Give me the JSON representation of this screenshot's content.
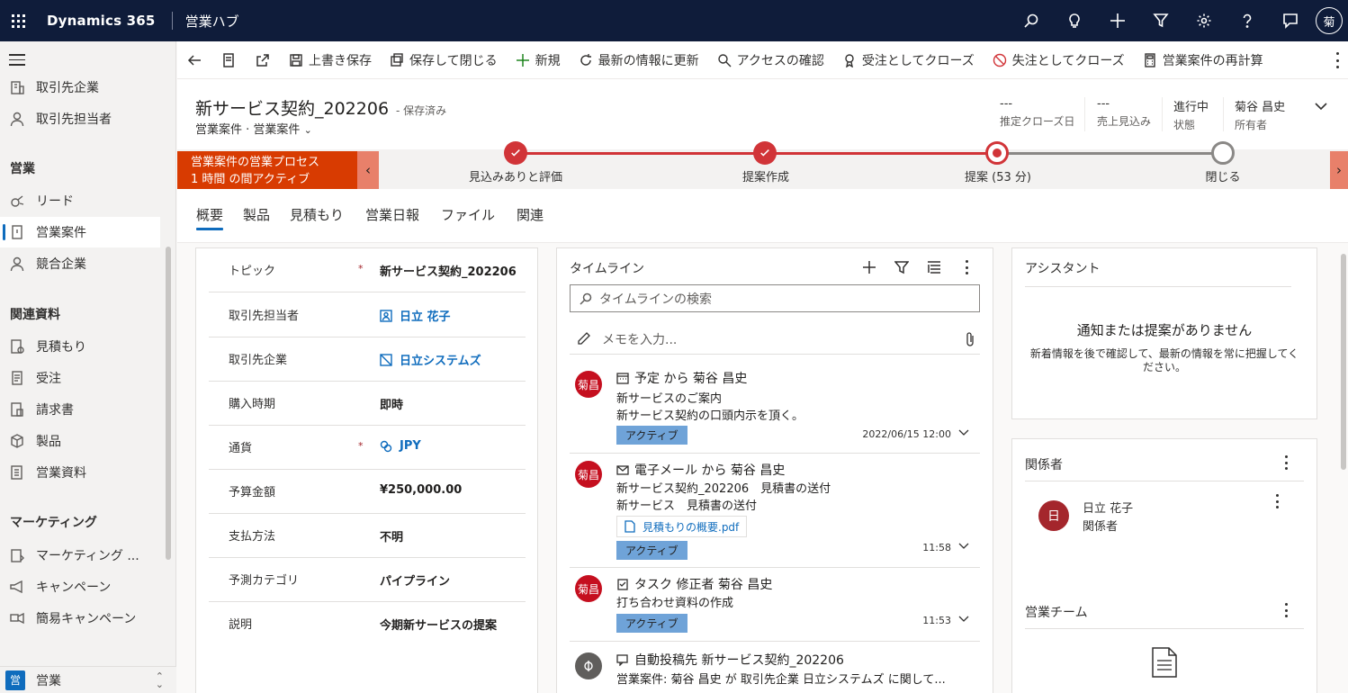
{
  "topbar": {
    "brand": "Dynamics 365",
    "app_name": "営業ハブ",
    "user_initial": "菊"
  },
  "sidebar": {
    "items_top": [
      {
        "label": "取引先企業",
        "icon": "building-icon"
      },
      {
        "label": "取引先担当者",
        "icon": "person-icon"
      }
    ],
    "groups": [
      {
        "title": "営業",
        "items": [
          {
            "label": "リード",
            "icon": "phone-icon"
          },
          {
            "label": "営業案件",
            "icon": "document-icon",
            "active": true
          },
          {
            "label": "競合企業",
            "icon": "person-icon"
          }
        ]
      },
      {
        "title": "関連資料",
        "items": [
          {
            "label": "見積もり",
            "icon": "quote-icon"
          },
          {
            "label": "受注",
            "icon": "order-icon"
          },
          {
            "label": "請求書",
            "icon": "invoice-icon"
          },
          {
            "label": "製品",
            "icon": "box-icon"
          },
          {
            "label": "営業資料",
            "icon": "library-icon"
          }
        ]
      },
      {
        "title": "マーケティング",
        "items": [
          {
            "label": "マーケティング ...",
            "icon": "list-icon"
          },
          {
            "label": "キャンペーン",
            "icon": "megaphone-icon"
          },
          {
            "label": "簡易キャンペーン",
            "icon": "quick-campaign-icon"
          }
        ]
      }
    ],
    "area": {
      "badge": "営",
      "label": "営業"
    }
  },
  "commandbar": {
    "save": "上書き保存",
    "save_close": "保存して閉じる",
    "new": "新規",
    "refresh": "最新の情報に更新",
    "check_access": "アクセスの確認",
    "close_won": "受注としてクローズ",
    "close_lost": "失注としてクローズ",
    "recalculate": "営業案件の再計算"
  },
  "header": {
    "title": "新サービス契約_202206",
    "saved_status": "- 保存済み",
    "entity": "営業案件",
    "form": "営業案件",
    "fields": [
      {
        "value": "---",
        "label": "推定クローズ日"
      },
      {
        "value": "---",
        "label": "売上見込み"
      },
      {
        "value": "進行中",
        "label": "状態"
      },
      {
        "value": "菊谷 昌史",
        "label": "所有者"
      }
    ]
  },
  "bpf": {
    "flyout_line1": "営業案件の営業プロセス",
    "flyout_line2": "1 時間 の間アクティブ",
    "stages": [
      {
        "label": "見込みありと評価",
        "state": "done"
      },
      {
        "label": "提案作成",
        "state": "done"
      },
      {
        "label": "提案 (53 分)",
        "state": "active"
      },
      {
        "label": "閉じる",
        "state": "pending"
      }
    ],
    "colors": {
      "done": "#d13438",
      "pending": "#8a8886",
      "flyout": "#d83b01"
    }
  },
  "tabs": [
    "概要",
    "製品",
    "見積もり",
    "営業日報",
    "ファイル",
    "関連"
  ],
  "summary": {
    "fields": [
      {
        "label": "トピック",
        "required": true,
        "value": "新サービス契約_202206"
      },
      {
        "label": "取引先担当者",
        "value": "日立 花子",
        "link": true,
        "icon": "contact-icon"
      },
      {
        "label": "取引先企業",
        "value": "日立システムズ",
        "link": true,
        "icon": "account-icon"
      },
      {
        "label": "購入時期",
        "value": "即時"
      },
      {
        "label": "通貨",
        "required": true,
        "value": "JPY",
        "link": true,
        "icon": "currency-icon"
      },
      {
        "label": "予算金額",
        "value": "¥250,000.00"
      },
      {
        "label": "支払方法",
        "value": "不明"
      },
      {
        "label": "予測カテゴリ",
        "value": "パイプライン"
      },
      {
        "label": "説明",
        "value": "今期新サービスの提案"
      }
    ]
  },
  "timeline": {
    "title": "タイムライン",
    "search_placeholder": "タイムラインの検索",
    "note_placeholder": "メモを入力...",
    "entries": [
      {
        "avatar": "菊昌",
        "heading": "予定 から 菊谷 昌史",
        "lines": [
          "新サービスのご案内",
          "新サービス契約の口頭内示を頂く。"
        ],
        "badge": "アクティブ",
        "time": "2022/06/15 12:00",
        "icon": "calendar-icon"
      },
      {
        "avatar": "菊昌",
        "heading": "電子メール から 菊谷 昌史",
        "lines": [
          "新サービス契約_202206　見積書の送付",
          "新サービス　見積書の送付"
        ],
        "attachment": "見積もりの概要.pdf",
        "badge": "アクティブ",
        "time": "11:58",
        "icon": "email-icon"
      },
      {
        "avatar": "菊昌",
        "heading": "タスク 修正者 菊谷 昌史",
        "lines": [
          "打ち合わせ資料の作成"
        ],
        "badge": "アクティブ",
        "time": "11:53",
        "icon": "task-icon"
      },
      {
        "avatar": "",
        "heading": "自動投稿先 新サービス契約_202206",
        "lines": [
          "営業案件: 菊谷 昌史 が 取引先企業 日立システムズ に関して..."
        ],
        "icon": "post-icon"
      }
    ]
  },
  "assistant": {
    "title": "アシスタント",
    "empty": "通知または提案がありません",
    "desc": "新着情報を後で確認して、最新の情報を常に把握してください。"
  },
  "stakeholders": {
    "title": "関係者",
    "person_initial": "日",
    "person_name": "日立 花子",
    "person_role": "関係者"
  },
  "sales_team": {
    "title": "営業チーム"
  }
}
